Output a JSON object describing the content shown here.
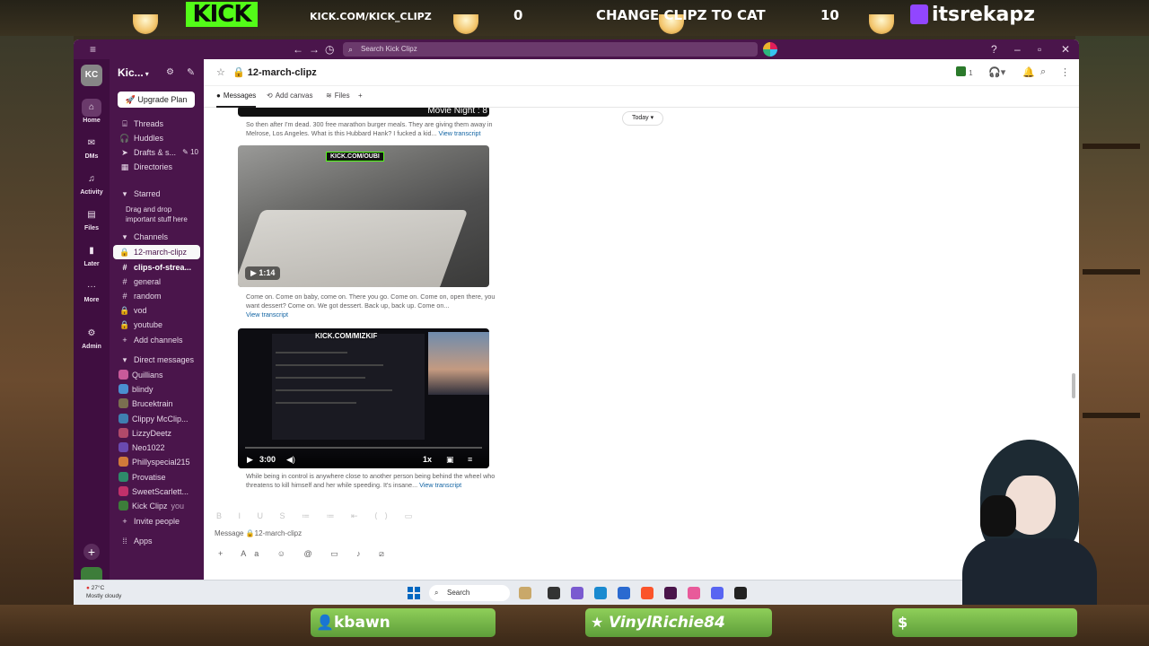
{
  "overlay": {
    "kick_logo": "KICK",
    "kick_url": "KICK.COM/KICK_CLIPZ",
    "score_left": "0",
    "poll_text": "CHANGE CLIPZ TO CAT",
    "score_right": "10",
    "twitch_handle": "itsrekapz",
    "bottom_pills": [
      "kbawn",
      "VinylRichie84",
      ""
    ]
  },
  "titlebar": {
    "search_placeholder": "Search Kick Clipz"
  },
  "rail": {
    "workspace_initials": "KC",
    "items": [
      {
        "label": "Home",
        "icon": "home-icon"
      },
      {
        "label": "DMs",
        "icon": "dms-icon"
      },
      {
        "label": "Activity",
        "icon": "bell-icon"
      },
      {
        "label": "Files",
        "icon": "files-icon"
      },
      {
        "label": "Later",
        "icon": "bookmark-icon"
      },
      {
        "label": "More",
        "icon": "more-icon"
      },
      {
        "label": "Admin",
        "icon": "gear-icon"
      }
    ]
  },
  "sidebar": {
    "workspace_name": "Kic...",
    "upgrade_label": "Upgrade Plan",
    "nav": [
      {
        "label": "Threads",
        "icon": "threads-icon"
      },
      {
        "label": "Huddles",
        "icon": "headphones-icon"
      },
      {
        "label": "Drafts & s...",
        "icon": "send-icon",
        "badge": "10"
      },
      {
        "label": "Directories",
        "icon": "directories-icon"
      }
    ],
    "starred_label": "Starred",
    "starred_hint": "Drag and drop important stuff here",
    "channels_label": "Channels",
    "channels": [
      {
        "name": "12-march-clipz",
        "prefix": "🔒"
      },
      {
        "name": "clips-of-strea...",
        "prefix": "#"
      },
      {
        "name": "general",
        "prefix": "#"
      },
      {
        "name": "random",
        "prefix": "#"
      },
      {
        "name": "vod",
        "prefix": "🔒"
      },
      {
        "name": "youtube",
        "prefix": "🔒"
      }
    ],
    "add_channels": "Add channels",
    "dm_label": "Direct messages",
    "dms": [
      {
        "name": "Quillians",
        "color": "#c85a9a"
      },
      {
        "name": "blindy",
        "color": "#4a8fd0"
      },
      {
        "name": "Brucektrain",
        "color": "#7a6f50"
      },
      {
        "name": "Clippy McClip...",
        "color": "#3f7fb0"
      },
      {
        "name": "LizzyDeetz",
        "color": "#b04a6a"
      },
      {
        "name": "Neo1022",
        "color": "#6a4ab0"
      },
      {
        "name": "Phillyspecial215",
        "color": "#d07a3a"
      },
      {
        "name": "Provatise",
        "color": "#2e8a6a"
      },
      {
        "name": "SweetScarlett...",
        "color": "#c0306a"
      },
      {
        "name": "Kick Clipz",
        "color": "#3d7d3a",
        "you": "you"
      }
    ],
    "invite_people": "Invite people",
    "apps": "Apps"
  },
  "channel": {
    "title": "12-march-clipz",
    "member_count": "1",
    "tabs": [
      {
        "label": "Messages",
        "icon": "messages-icon"
      },
      {
        "label": "Add canvas",
        "icon": "canvas-icon"
      },
      {
        "label": "Files",
        "icon": "files-icon"
      }
    ],
    "day_divider": "Today"
  },
  "messages": [
    {
      "video_title": "Movie Night : 8",
      "text": "So then after I'm dead. 300 free marathon burger meals. They are giving them away in Melrose, Los Angeles. What is this Hubbard Hank? I fucked a kid...",
      "link": "View transcript"
    },
    {
      "watermark": "KICK.COM/OUBI",
      "duration": "1:14",
      "text": "Come on. Come on baby, come on. There you go. Come on. Come on, open there, you want dessert? Come on. We got dessert. Back up, back up. Come on...",
      "link": "View transcript"
    },
    {
      "watermark": "KICK.COM/MIZKIF",
      "duration": "3:00",
      "speed": "1x",
      "text": "While being in control is anywhere close to another person being behind the wheel who threatens to kill himself and her while speeding. It's insane...",
      "link": "View transcript"
    }
  ],
  "composer": {
    "placeholder": "Message 🔒12-march-clipz"
  },
  "taskbar": {
    "temperature": "27°C",
    "weather": "Mostly cloudy",
    "search_label": "Search"
  }
}
